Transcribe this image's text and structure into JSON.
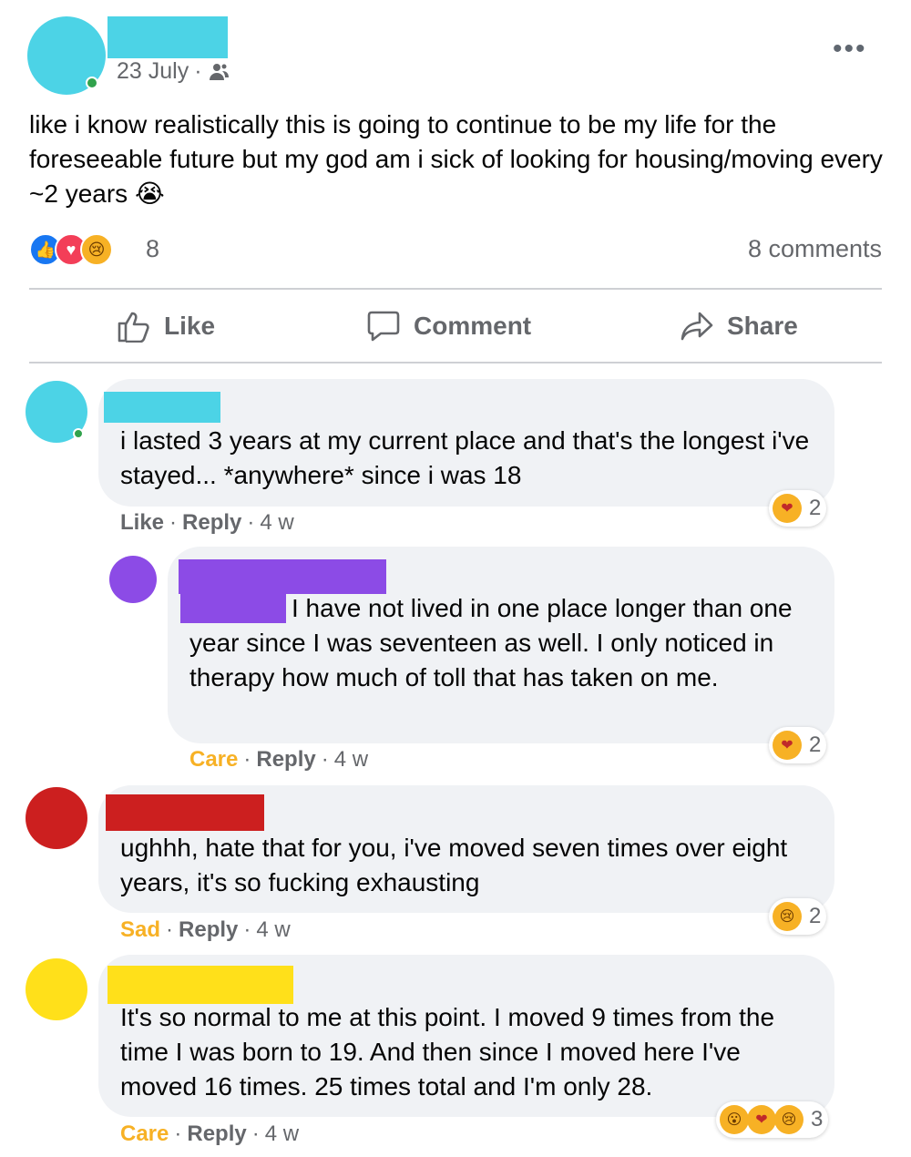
{
  "post": {
    "date": "23 July",
    "audience_icon": "friends-icon",
    "body": "like i know realistically this is going to continue to be my life for the foreseeable future but my god am i sick of looking for housing/moving every ~2 years 😭",
    "reaction_count": "8",
    "comments_label": "8 comments",
    "colors": {
      "author_avatar": "#4cd3e6",
      "author_redaction": "#4cd3e6"
    }
  },
  "actions": {
    "like": "Like",
    "comment": "Comment",
    "share": "Share"
  },
  "comments": [
    {
      "text": "i lasted 3 years at my current place and that's the longest i've stayed... *anywhere* since i was 18",
      "reaction": "Like",
      "reply": "Reply",
      "time": "4 w",
      "reaction_count": "2",
      "color": "#4cd3e6"
    },
    {
      "text": "I have not lived in one place longer than one year since I was seventeen as well. I only noticed in therapy how much of toll that has taken on me.",
      "reaction": "Care",
      "reply": "Reply",
      "time": "4 w",
      "reaction_count": "2",
      "color": "#8c4be6"
    },
    {
      "text": "ughhh, hate that for you, i've moved seven times over eight years, it's so fucking exhausting",
      "reaction": "Sad",
      "reply": "Reply",
      "time": "4 w",
      "reaction_count": "2",
      "color": "#cc1f1f"
    },
    {
      "text": "It's so normal to me at this point. I moved 9 times from the time I was born to 19. And then since I moved here I've moved 16 times. 25 times total and I'm only 28.",
      "reaction": "Care",
      "reply": "Reply",
      "time": "4 w",
      "reaction_count": "3",
      "color": "#ffe01a"
    }
  ]
}
